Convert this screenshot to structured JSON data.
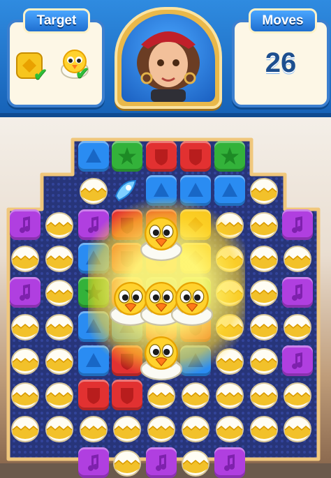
{
  "hud": {
    "target_label": "Target",
    "moves_label": "Moves",
    "moves_value": "26",
    "goals": [
      {
        "name": "yellow-block",
        "completed": true
      },
      {
        "name": "chick",
        "completed": true
      }
    ]
  },
  "colors": {
    "blue": "#2a8cf2",
    "green": "#33b23a",
    "red": "#e23131",
    "purple": "#b03fe0",
    "yellow": "#f7c51e",
    "hud": "#1f74d2"
  },
  "icons": {
    "blue": "triangle-icon",
    "green": "star-icon",
    "red": "shield-icon",
    "purple": "music-note-icon",
    "yellow": "diamond-icon",
    "egg": "egg-icon",
    "rocket": "rocket-icon",
    "chick": "chick-icon"
  }
}
